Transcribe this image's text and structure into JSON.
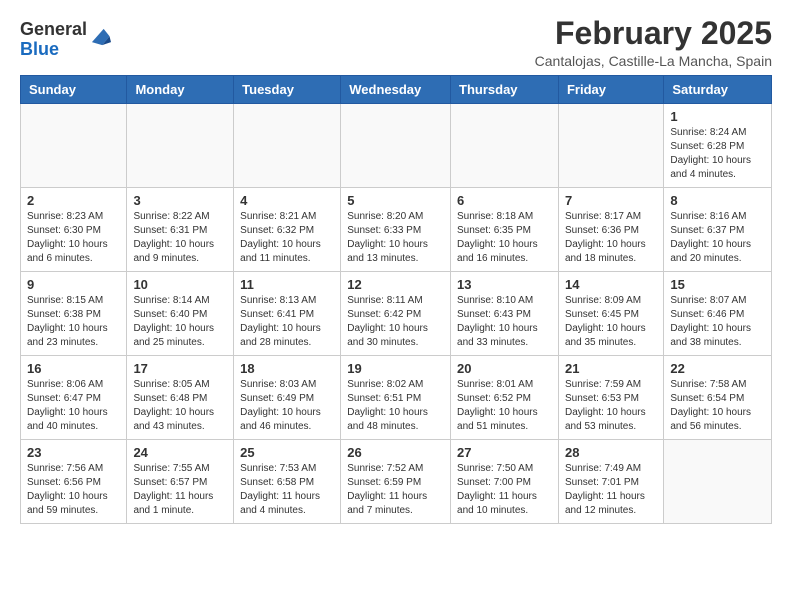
{
  "header": {
    "logo_general": "General",
    "logo_blue": "Blue",
    "month_title": "February 2025",
    "subtitle": "Cantalojas, Castille-La Mancha, Spain"
  },
  "weekdays": [
    "Sunday",
    "Monday",
    "Tuesday",
    "Wednesday",
    "Thursday",
    "Friday",
    "Saturday"
  ],
  "weeks": [
    [
      {
        "day": "",
        "info": ""
      },
      {
        "day": "",
        "info": ""
      },
      {
        "day": "",
        "info": ""
      },
      {
        "day": "",
        "info": ""
      },
      {
        "day": "",
        "info": ""
      },
      {
        "day": "",
        "info": ""
      },
      {
        "day": "1",
        "info": "Sunrise: 8:24 AM\nSunset: 6:28 PM\nDaylight: 10 hours\nand 4 minutes."
      }
    ],
    [
      {
        "day": "2",
        "info": "Sunrise: 8:23 AM\nSunset: 6:30 PM\nDaylight: 10 hours\nand 6 minutes."
      },
      {
        "day": "3",
        "info": "Sunrise: 8:22 AM\nSunset: 6:31 PM\nDaylight: 10 hours\nand 9 minutes."
      },
      {
        "day": "4",
        "info": "Sunrise: 8:21 AM\nSunset: 6:32 PM\nDaylight: 10 hours\nand 11 minutes."
      },
      {
        "day": "5",
        "info": "Sunrise: 8:20 AM\nSunset: 6:33 PM\nDaylight: 10 hours\nand 13 minutes."
      },
      {
        "day": "6",
        "info": "Sunrise: 8:18 AM\nSunset: 6:35 PM\nDaylight: 10 hours\nand 16 minutes."
      },
      {
        "day": "7",
        "info": "Sunrise: 8:17 AM\nSunset: 6:36 PM\nDaylight: 10 hours\nand 18 minutes."
      },
      {
        "day": "8",
        "info": "Sunrise: 8:16 AM\nSunset: 6:37 PM\nDaylight: 10 hours\nand 20 minutes."
      }
    ],
    [
      {
        "day": "9",
        "info": "Sunrise: 8:15 AM\nSunset: 6:38 PM\nDaylight: 10 hours\nand 23 minutes."
      },
      {
        "day": "10",
        "info": "Sunrise: 8:14 AM\nSunset: 6:40 PM\nDaylight: 10 hours\nand 25 minutes."
      },
      {
        "day": "11",
        "info": "Sunrise: 8:13 AM\nSunset: 6:41 PM\nDaylight: 10 hours\nand 28 minutes."
      },
      {
        "day": "12",
        "info": "Sunrise: 8:11 AM\nSunset: 6:42 PM\nDaylight: 10 hours\nand 30 minutes."
      },
      {
        "day": "13",
        "info": "Sunrise: 8:10 AM\nSunset: 6:43 PM\nDaylight: 10 hours\nand 33 minutes."
      },
      {
        "day": "14",
        "info": "Sunrise: 8:09 AM\nSunset: 6:45 PM\nDaylight: 10 hours\nand 35 minutes."
      },
      {
        "day": "15",
        "info": "Sunrise: 8:07 AM\nSunset: 6:46 PM\nDaylight: 10 hours\nand 38 minutes."
      }
    ],
    [
      {
        "day": "16",
        "info": "Sunrise: 8:06 AM\nSunset: 6:47 PM\nDaylight: 10 hours\nand 40 minutes."
      },
      {
        "day": "17",
        "info": "Sunrise: 8:05 AM\nSunset: 6:48 PM\nDaylight: 10 hours\nand 43 minutes."
      },
      {
        "day": "18",
        "info": "Sunrise: 8:03 AM\nSunset: 6:49 PM\nDaylight: 10 hours\nand 46 minutes."
      },
      {
        "day": "19",
        "info": "Sunrise: 8:02 AM\nSunset: 6:51 PM\nDaylight: 10 hours\nand 48 minutes."
      },
      {
        "day": "20",
        "info": "Sunrise: 8:01 AM\nSunset: 6:52 PM\nDaylight: 10 hours\nand 51 minutes."
      },
      {
        "day": "21",
        "info": "Sunrise: 7:59 AM\nSunset: 6:53 PM\nDaylight: 10 hours\nand 53 minutes."
      },
      {
        "day": "22",
        "info": "Sunrise: 7:58 AM\nSunset: 6:54 PM\nDaylight: 10 hours\nand 56 minutes."
      }
    ],
    [
      {
        "day": "23",
        "info": "Sunrise: 7:56 AM\nSunset: 6:56 PM\nDaylight: 10 hours\nand 59 minutes."
      },
      {
        "day": "24",
        "info": "Sunrise: 7:55 AM\nSunset: 6:57 PM\nDaylight: 11 hours\nand 1 minute."
      },
      {
        "day": "25",
        "info": "Sunrise: 7:53 AM\nSunset: 6:58 PM\nDaylight: 11 hours\nand 4 minutes."
      },
      {
        "day": "26",
        "info": "Sunrise: 7:52 AM\nSunset: 6:59 PM\nDaylight: 11 hours\nand 7 minutes."
      },
      {
        "day": "27",
        "info": "Sunrise: 7:50 AM\nSunset: 7:00 PM\nDaylight: 11 hours\nand 10 minutes."
      },
      {
        "day": "28",
        "info": "Sunrise: 7:49 AM\nSunset: 7:01 PM\nDaylight: 11 hours\nand 12 minutes."
      },
      {
        "day": "",
        "info": ""
      }
    ]
  ]
}
